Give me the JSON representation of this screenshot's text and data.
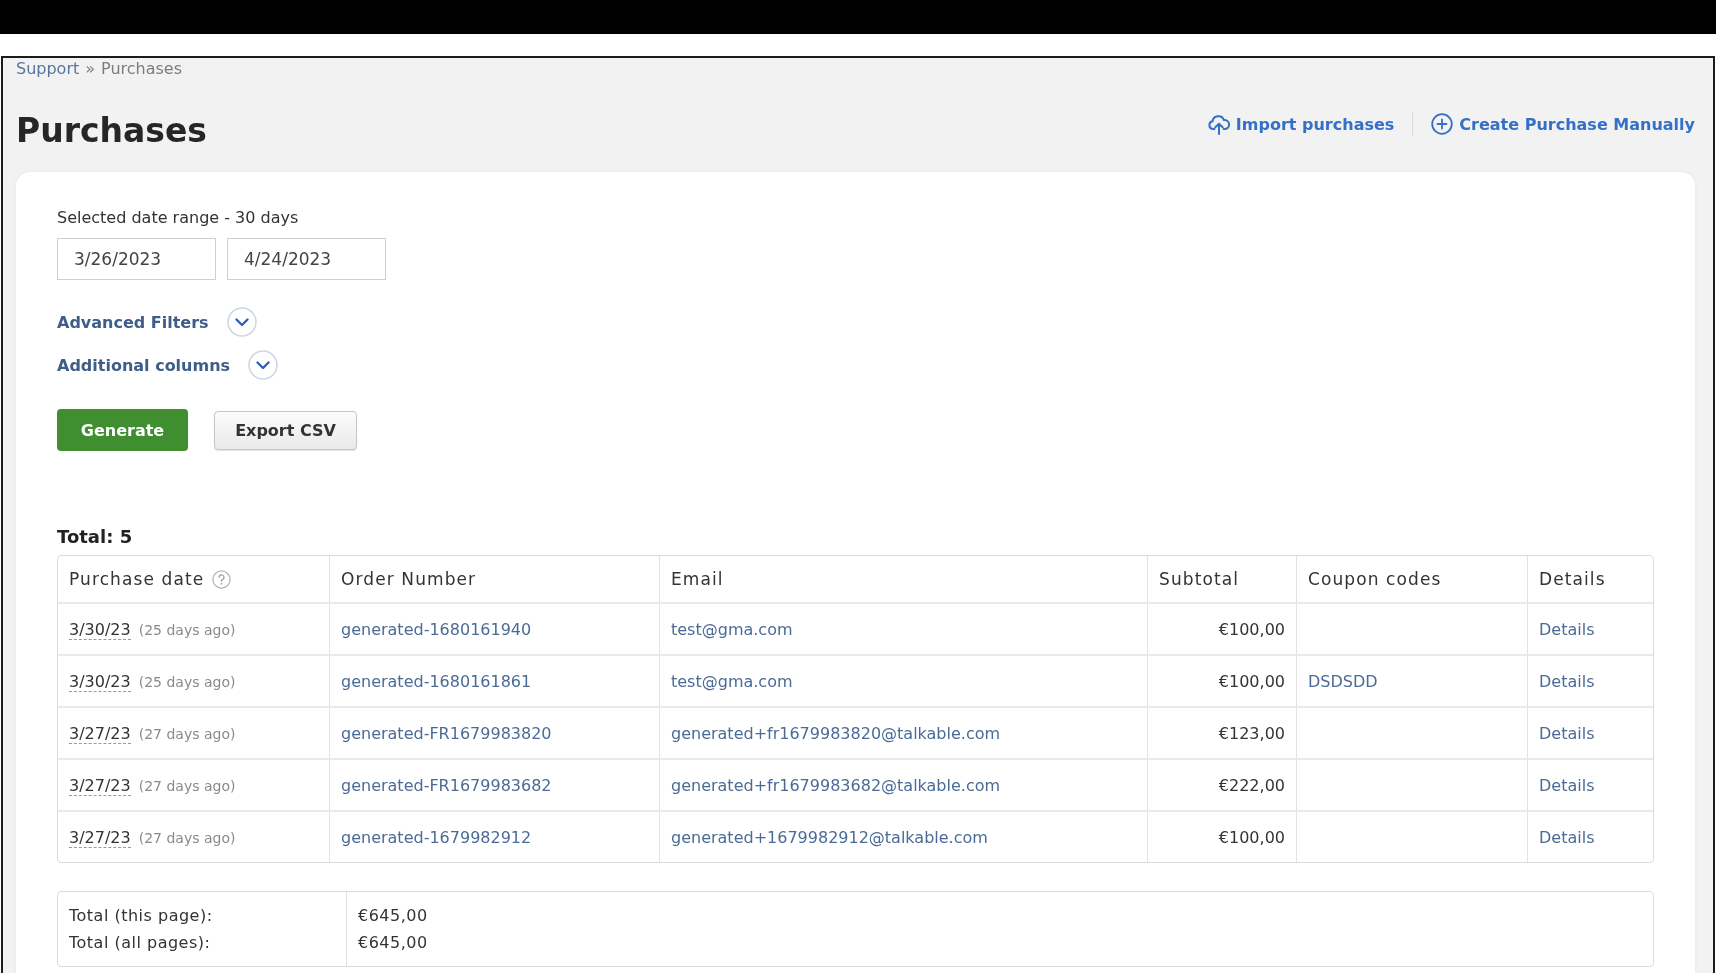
{
  "breadcrumb": {
    "link": "Support",
    "separator": "»",
    "current": "Purchases"
  },
  "title": "Purchases",
  "actions": [
    {
      "kind": "import",
      "label": "Import purchases"
    },
    {
      "kind": "create",
      "label": "Create Purchase Manually"
    }
  ],
  "date_range": {
    "label": "Selected date range - 30 days",
    "start": "3/26/2023",
    "end": "4/24/2023"
  },
  "toggles": [
    {
      "label": "Advanced Filters",
      "expanded": false
    },
    {
      "label": "Additional columns",
      "expanded": false
    }
  ],
  "buttons": [
    {
      "kind": "primary",
      "label": "Generate"
    },
    {
      "kind": "secondary",
      "label": "Export CSV"
    }
  ],
  "total": "Total: 5",
  "table": {
    "columns": [
      {
        "label": "Purchase date",
        "help": true
      },
      {
        "label": "Order Number",
        "help": false
      },
      {
        "label": "Email",
        "help": false
      },
      {
        "label": "Subtotal",
        "help": false
      },
      {
        "label": "Coupon codes",
        "help": false
      },
      {
        "label": "Details",
        "help": false
      }
    ],
    "rows": [
      {
        "date": "3/30/23",
        "ago": "(25 days ago)",
        "order_number": "generated-1680161940",
        "email": "test@gma.com",
        "subtotal": "€100,00",
        "details": "Details"
      },
      {
        "date": "3/30/23",
        "ago": "(25 days ago)",
        "order_number": "generated-1680161861",
        "email": "test@gma.com",
        "subtotal": "€100,00",
        "coupon": "DSDSDD",
        "details": "Details"
      },
      {
        "date": "3/27/23",
        "ago": "(27 days ago)",
        "order_number": "generated-FR1679983820",
        "email": "generated+fr1679983820@talkable.com",
        "subtotal": "€123,00",
        "details": "Details"
      },
      {
        "date": "3/27/23",
        "ago": "(27 days ago)",
        "order_number": "generated-FR1679983682",
        "email": "generated+fr1679983682@talkable.com",
        "subtotal": "€222,00",
        "details": "Details"
      },
      {
        "date": "3/27/23",
        "ago": "(27 days ago)",
        "order_number": "generated-1679982912",
        "email": "generated+1679982912@talkable.com",
        "subtotal": "€100,00",
        "details": "Details"
      }
    ]
  },
  "totals": [
    {
      "label": "Total (this page):",
      "value": "€645,00"
    },
    {
      "label": "Total (all pages):",
      "value": "€645,00"
    }
  ]
}
